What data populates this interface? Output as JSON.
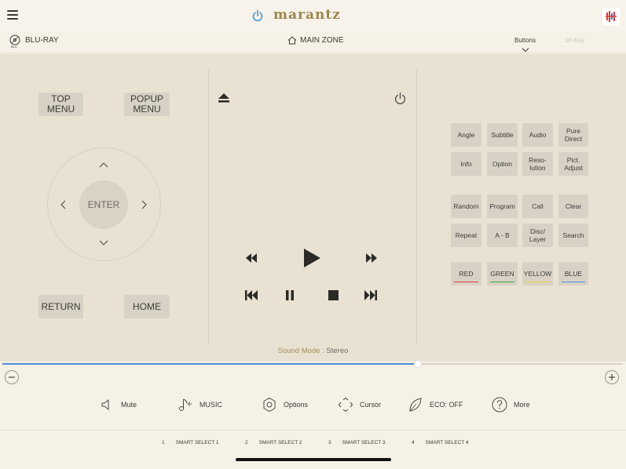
{
  "header": {
    "brand": "marantz"
  },
  "source": {
    "label": "BLU-RAY",
    "icon_sub": "BLU"
  },
  "zone": {
    "label": "MAIN ZONE"
  },
  "view_tabs": {
    "buttons": "Buttons",
    "ten_key": "10 Key"
  },
  "left_panel": {
    "top_menu": "TOP\nMENU",
    "popup_menu": "POPUP\nMENU",
    "enter": "ENTER",
    "return": "RETURN",
    "home": "HOME"
  },
  "function_grid": {
    "row1": [
      "Angle",
      "Subtitle",
      "Audio",
      "Pure\nDirect"
    ],
    "row2": [
      "Info",
      "Option",
      "Reso-\nlution",
      "Pict.\nAdjust"
    ],
    "row3": [
      "Random",
      "Program",
      "Call",
      "Clear"
    ],
    "row4": [
      "Repeat",
      "A - B",
      "Disc/\nLayer",
      "Search"
    ],
    "colors": [
      "RED",
      "GREEN",
      "YELLOW",
      "BLUE"
    ]
  },
  "color_values": {
    "red": "#e03a3a",
    "green": "#3aa53a",
    "yellow": "#e8d84a",
    "blue": "#4a90d9",
    "accent": "#a58d5a",
    "power_blue": "#3e9ad6"
  },
  "sound_mode": {
    "label": "Sound Mode : ",
    "value": "Stereo"
  },
  "volume": {
    "level_fraction": 0.67
  },
  "functions": {
    "mute": "Mute",
    "music": "MUSIC",
    "options": "Options",
    "cursor": "Cursor",
    "eco": "ECO: OFF",
    "more": "More"
  },
  "smart_select": [
    {
      "num": "1",
      "label": "SMART SELECT 1"
    },
    {
      "num": "2",
      "label": "SMART SELECT 2"
    },
    {
      "num": "3",
      "label": "SMART SELECT 3"
    },
    {
      "num": "4",
      "label": "SMART SELECT 4"
    }
  ]
}
